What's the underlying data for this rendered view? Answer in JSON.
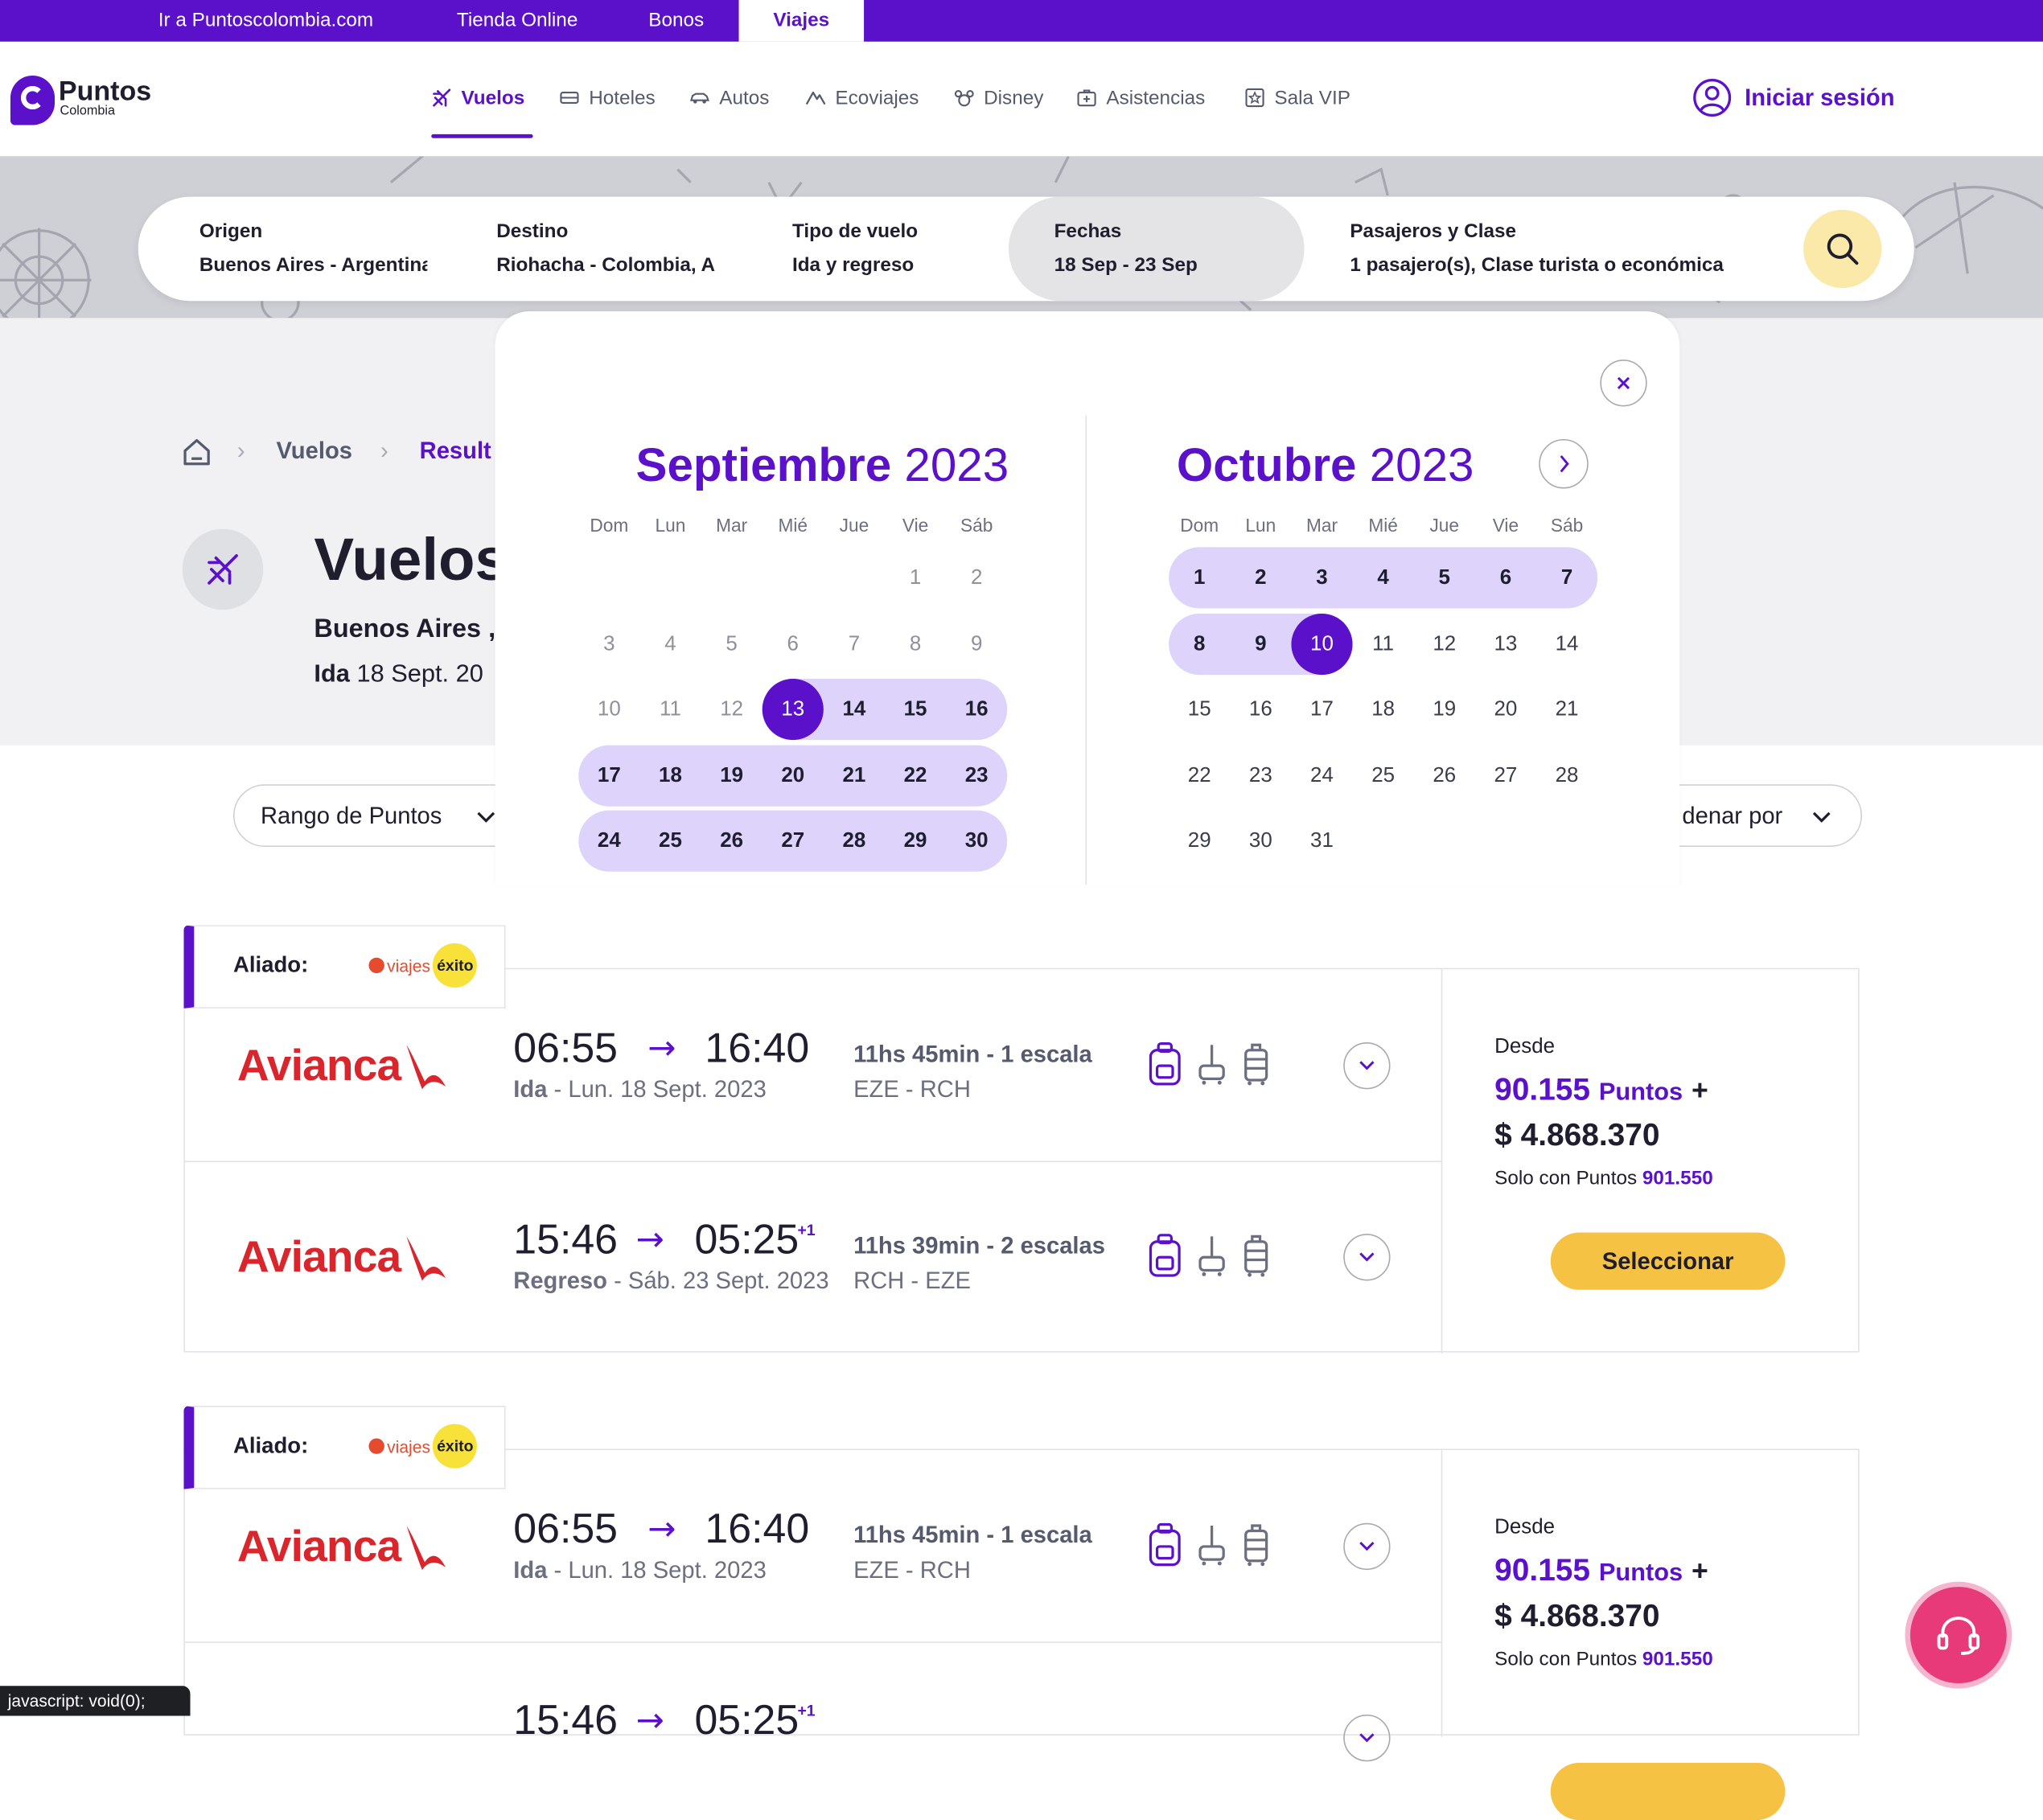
{
  "topbar": {
    "links": [
      {
        "label": "Ir a Puntoscolombia.com"
      },
      {
        "label": "Tienda Online"
      },
      {
        "label": "Bonos"
      },
      {
        "label": "Viajes",
        "active": true
      }
    ]
  },
  "brand": {
    "name": "Puntos",
    "sub": "Colombia"
  },
  "nav": {
    "items": [
      {
        "label": "Vuelos",
        "icon": "plane-icon",
        "active": true
      },
      {
        "label": "Hoteles",
        "icon": "bed-icon"
      },
      {
        "label": "Autos",
        "icon": "car-icon"
      },
      {
        "label": "Ecoviajes",
        "icon": "mountain-icon"
      },
      {
        "label": "Disney",
        "icon": "mickey-icon"
      },
      {
        "label": "Asistencias",
        "icon": "first-aid-icon"
      },
      {
        "label": "Sala VIP",
        "icon": "star-icon"
      }
    ],
    "login": "Iniciar sesión"
  },
  "search": {
    "origen_label": "Origen",
    "origen_value": "Buenos Aires - Argentina",
    "destino_label": "Destino",
    "destino_value": "Riohacha - Colombia, A",
    "tipo_label": "Tipo de vuelo",
    "tipo_value": "Ida y regreso",
    "fechas_label": "Fechas",
    "fechas_value": "18 Sep - 23 Sep",
    "pasajeros_label": "Pasajeros y Clase",
    "pasajeros_value": "1 pasajero(s), Clase turista o económica"
  },
  "breadcrumb": {
    "vuelos": "Vuelos",
    "resultados": "Result"
  },
  "page": {
    "title": "Vuelos",
    "route": "Buenos Aires ,",
    "ida_label": "Ida",
    "ida_date": "18 Sept. 20"
  },
  "filters": {
    "rango": "Rango de Puntos",
    "ordenar": "denar por"
  },
  "calendar": {
    "dow": [
      "Dom",
      "Lun",
      "Mar",
      "Mié",
      "Jue",
      "Vie",
      "Sáb"
    ],
    "months": [
      {
        "name": "Septiembre",
        "year": "2023",
        "first_weekday": 5,
        "days": 30,
        "range_start": 13,
        "range_end": 30,
        "selected": [
          13
        ],
        "past_until": 12
      },
      {
        "name": "Octubre",
        "year": "2023",
        "first_weekday": 0,
        "days": 31,
        "range_start": 1,
        "range_end": 10,
        "selected": [
          10
        ],
        "past_until": 0
      }
    ],
    "close": "×"
  },
  "results": [
    {
      "aliado_label": "Aliado:",
      "aliado_logo": "viajes éxito",
      "legs": [
        {
          "airline": "Avianca",
          "dep": "06:55",
          "arr": "16:40",
          "plus": "",
          "dir": "Ida",
          "date": "Lun. 18 Sept. 2023",
          "duration": "11hs 45min - 1 escala",
          "route": "EZE - RCH"
        },
        {
          "airline": "Avianca",
          "dep": "15:46",
          "arr": "05:25",
          "plus": "+1",
          "dir": "Regreso",
          "date": "Sáb. 23 Sept. 2023",
          "duration": "11hs 39min - 2 escalas",
          "route": "RCH - EZE"
        }
      ],
      "price": {
        "desde": "Desde",
        "points": "90.155",
        "points_unit": "Puntos",
        "plus": "+",
        "money": "$ 4.868.370",
        "solo_label": "Solo con Puntos",
        "solo_value": "901.550",
        "button": "Seleccionar"
      }
    },
    {
      "aliado_label": "Aliado:",
      "aliado_logo": "viajes éxito",
      "legs": [
        {
          "airline": "Avianca",
          "dep": "06:55",
          "arr": "16:40",
          "plus": "",
          "dir": "Ida",
          "date": "Lun. 18 Sept. 2023",
          "duration": "11hs 45min - 1 escala",
          "route": "EZE - RCH"
        },
        {
          "airline": "Avianca",
          "dep": "15:46",
          "arr": "05:25",
          "plus": "+1",
          "dir": "",
          "date": "",
          "duration": "",
          "route": ""
        }
      ],
      "price": {
        "desde": "Desde",
        "points": "90.155",
        "points_unit": "Puntos",
        "plus": "+",
        "money": "$ 4.868.370",
        "solo_label": "Solo con Puntos",
        "solo_value": "901.550",
        "button": ""
      }
    }
  ],
  "statusbar": "javascript: void(0);",
  "colors": {
    "brand": "#5b10c9",
    "accent": "#f6c244",
    "range": "#ddd3fb",
    "chat": "#e83a78"
  }
}
